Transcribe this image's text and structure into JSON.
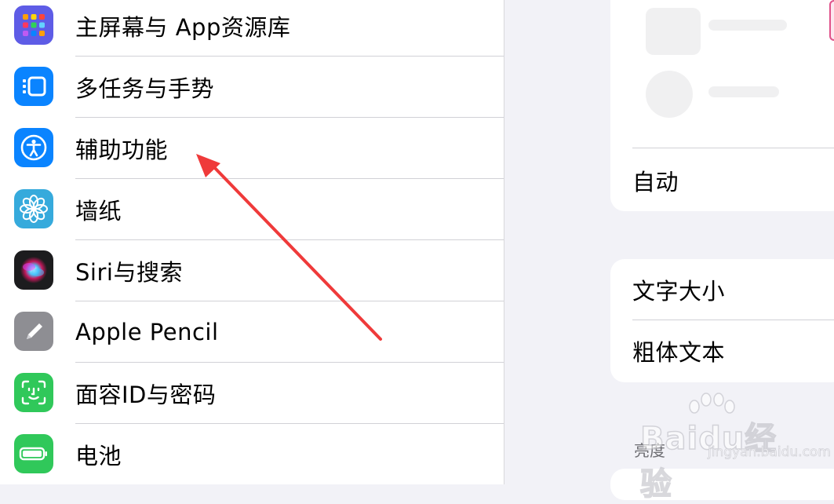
{
  "sidebar": {
    "items": [
      {
        "label": "主屏幕与 App资源库",
        "icon": "home-screen-grid-icon",
        "color": "#5e5ce6"
      },
      {
        "label": "多任务与手势",
        "icon": "multitasking-icon",
        "color": "#0a84ff"
      },
      {
        "label": "辅助功能",
        "icon": "accessibility-icon",
        "color": "#0a84ff"
      },
      {
        "label": "墙纸",
        "icon": "wallpaper-flower-icon",
        "color": "#36aadc"
      },
      {
        "label": "Siri与搜索",
        "icon": "siri-icon",
        "color": "#1c1c1e"
      },
      {
        "label": "Apple Pencil",
        "icon": "pencil-icon",
        "color": "#8e8e93"
      },
      {
        "label": "面容ID与密码",
        "icon": "face-id-icon",
        "color": "#30c85a"
      },
      {
        "label": "电池",
        "icon": "battery-icon",
        "color": "#30c85a"
      }
    ]
  },
  "detail": {
    "appearance_auto_label": "自动",
    "text_size_label": "文字大小",
    "bold_text_label": "粗体文本",
    "brightness_header": "亮度"
  },
  "watermark": {
    "brand": "Baidu经验",
    "url": "jingyan.baidu.com"
  },
  "colors": {
    "annotation_arrow": "#ef3a3a",
    "pink_accent": "#e0528a"
  }
}
